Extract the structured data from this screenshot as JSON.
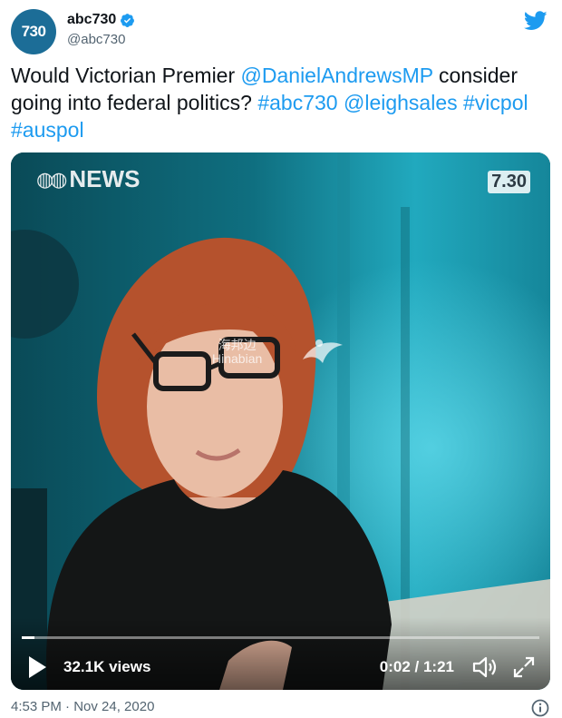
{
  "account": {
    "display_name": "abc730",
    "handle": "@abc730",
    "avatar_text": "730",
    "verified": true
  },
  "tweet": {
    "parts": [
      {
        "text": "Would Victorian Premier ",
        "type": "text"
      },
      {
        "text": "@DanielAndrewsMP",
        "type": "mention"
      },
      {
        "text": " consider going into federal politics? ",
        "type": "text"
      },
      {
        "text": "#abc730",
        "type": "hashtag"
      },
      {
        "text": " ",
        "type": "text"
      },
      {
        "text": "@leighsales",
        "type": "mention"
      },
      {
        "text": " ",
        "type": "text"
      },
      {
        "text": "#vicpol",
        "type": "hashtag"
      },
      {
        "text": " ",
        "type": "text"
      },
      {
        "text": "#auspol",
        "type": "hashtag"
      }
    ],
    "timestamp": "4:53 PM · Nov 24, 2020"
  },
  "video": {
    "channel_logo": "NEWS",
    "program_tag": "7.30",
    "watermark_cn": "海邦边",
    "watermark_en": "Hinabian",
    "views": "32.1K views",
    "time": "0:02 / 1:21",
    "progress": 0.025
  },
  "icons": {
    "brand": "twitter-bird-icon",
    "verified": "verified-badge-icon",
    "play": "play-icon",
    "volume": "volume-icon",
    "fullscreen": "fullscreen-icon",
    "info": "info-icon"
  },
  "colors": {
    "link": "#1d9bf0",
    "twitter_blue": "#1d9bf0",
    "muted": "#536471"
  }
}
